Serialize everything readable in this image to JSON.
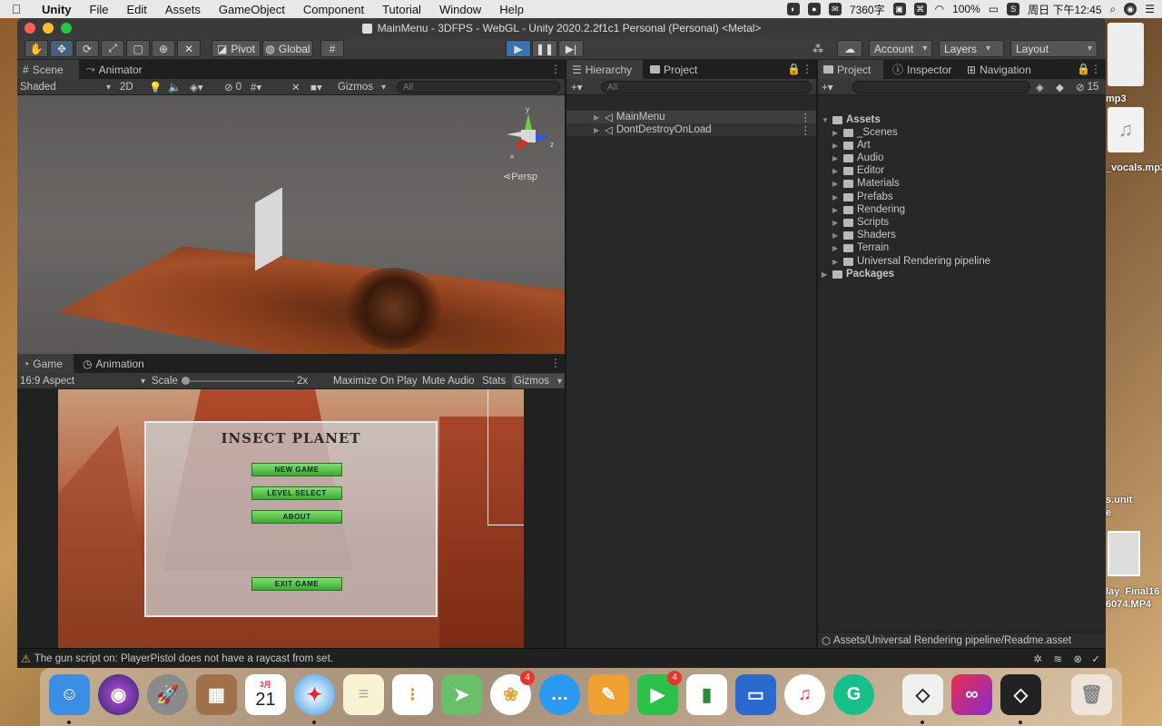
{
  "menubar": {
    "app_name": "Unity",
    "items": [
      "File",
      "Edit",
      "Assets",
      "GameObject",
      "Component",
      "Tutorial",
      "Window",
      "Help"
    ],
    "status": {
      "char_count": "7360字",
      "battery": "100%",
      "datetime": "周日 下午12:45"
    }
  },
  "window": {
    "title": "MainMenu - 3DFPS - WebGL - Unity 2020.2.2f1c1 Personal (Personal) <Metal>"
  },
  "toolbar": {
    "pivot": "Pivot",
    "global": "Global",
    "account": "Account",
    "layers": "Layers",
    "layout": "Layout"
  },
  "scene_panel": {
    "tabs": [
      "Scene",
      "Animator"
    ],
    "shading": "Shaded",
    "mode_2d": "2D",
    "hidden_count": "0",
    "gizmos": "Gizmos",
    "search_placeholder": "All",
    "projection": "Persp",
    "gizmo_axes": {
      "y": "y",
      "x": "x",
      "z": "z"
    }
  },
  "game_panel": {
    "tabs": [
      "Game",
      "Animation"
    ],
    "aspect": "16:9 Aspect",
    "scale_label": "Scale",
    "scale_value": "2x",
    "maximize": "Maximize On Play",
    "mute": "Mute Audio",
    "stats": "Stats",
    "gizmos": "Gizmos",
    "menu": {
      "title": "INSECT PLANET",
      "buttons": [
        "NEW GAME",
        "LEVEL SELECT",
        "ABOUT",
        "EXIT GAME"
      ]
    }
  },
  "hierarchy_panel": {
    "tabs": [
      "Hierarchy",
      "Project"
    ],
    "search_placeholder": "All",
    "items": [
      "MainMenu",
      "DontDestroyOnLoad"
    ]
  },
  "project_panel": {
    "tabs": [
      "Project",
      "Inspector",
      "Navigation"
    ],
    "hidden_count": "15",
    "root": "Assets",
    "folders": [
      "_Scenes",
      "Art",
      "Audio",
      "Editor",
      "Materials",
      "Prefabs",
      "Rendering",
      "Scripts",
      "Shaders",
      "Terrain",
      "Universal Rendering pipeline"
    ],
    "packages": "Packages",
    "selected_path": "Assets/Universal Rendering pipeline/Readme.asset"
  },
  "status_bar": {
    "message": "The gun script on: PlayerPistol does not have a raycast from set."
  },
  "desktop": {
    "labels": [
      "mp3",
      "_vocals.mp3",
      "s.unit",
      "e",
      "lay_Final16",
      "6074.MP4"
    ]
  },
  "dock": {
    "calendar_month": "3月",
    "calendar_day": "21",
    "photos_badge": "4",
    "facetime_badge": "4"
  }
}
